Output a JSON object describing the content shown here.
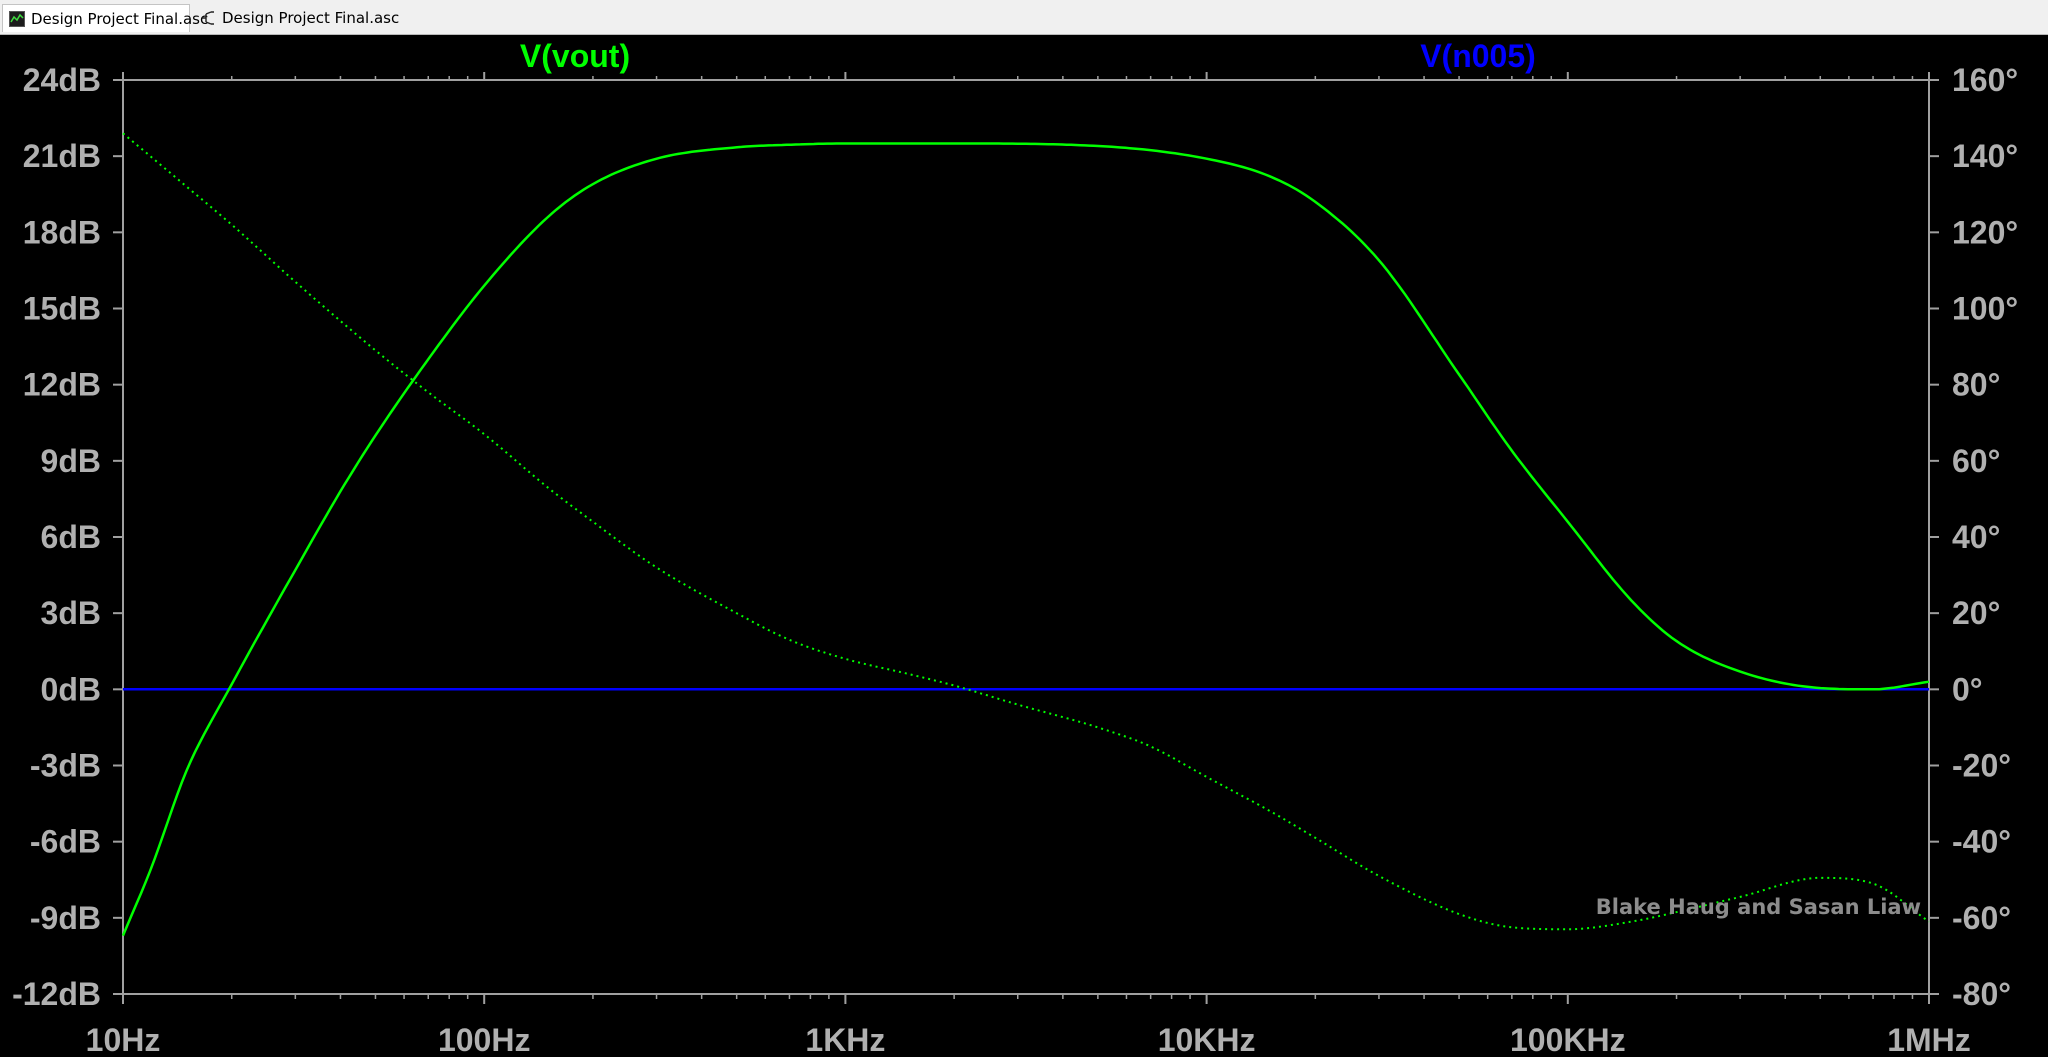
{
  "window": {
    "tabs": [
      {
        "label": "Design Project Final.asc",
        "icon": "waveform-icon",
        "active": true
      },
      {
        "label": "Design Project Final.asc",
        "icon": "schematic-icon",
        "active": false
      }
    ]
  },
  "watermark": "Blake Haug and Sasan Liaw",
  "colors": {
    "background": "#000000",
    "axis": "#a0a0a0",
    "tick_text": "#b0b0b0",
    "vout": "#00ff00",
    "n005": "#0000ff"
  },
  "chart_data": {
    "type": "line",
    "x_scale": "log",
    "xlim": [
      10,
      1000000
    ],
    "x_ticks": [
      {
        "value": 10,
        "label": "10Hz"
      },
      {
        "value": 100,
        "label": "100Hz"
      },
      {
        "value": 1000,
        "label": "1KHz"
      },
      {
        "value": 10000,
        "label": "10KHz"
      },
      {
        "value": 100000,
        "label": "100KHz"
      },
      {
        "value": 1000000,
        "label": "1MHz"
      }
    ],
    "y_left": {
      "unit": "dB",
      "lim": [
        -12,
        24
      ],
      "ticks": [
        {
          "value": 24,
          "label": "24dB"
        },
        {
          "value": 21,
          "label": "21dB"
        },
        {
          "value": 18,
          "label": "18dB"
        },
        {
          "value": 15,
          "label": "15dB"
        },
        {
          "value": 12,
          "label": "12dB"
        },
        {
          "value": 9,
          "label": "9dB"
        },
        {
          "value": 6,
          "label": "6dB"
        },
        {
          "value": 3,
          "label": "3dB"
        },
        {
          "value": 0,
          "label": "0dB"
        },
        {
          "value": -3,
          "label": "-3dB"
        },
        {
          "value": -6,
          "label": "-6dB"
        },
        {
          "value": -9,
          "label": "-9dB"
        },
        {
          "value": -12,
          "label": "-12dB"
        }
      ]
    },
    "y_right": {
      "unit": "°",
      "lim": [
        -80,
        160
      ],
      "ticks": [
        {
          "value": 160,
          "label": "160°"
        },
        {
          "value": 140,
          "label": "140°"
        },
        {
          "value": 120,
          "label": "120°"
        },
        {
          "value": 100,
          "label": "100°"
        },
        {
          "value": 80,
          "label": "80°"
        },
        {
          "value": 60,
          "label": "60°"
        },
        {
          "value": 40,
          "label": "40°"
        },
        {
          "value": 20,
          "label": "20°"
        },
        {
          "value": 0,
          "label": "0°"
        },
        {
          "value": -20,
          "label": "-20°"
        },
        {
          "value": -40,
          "label": "-40°"
        },
        {
          "value": -60,
          "label": "-60°"
        },
        {
          "value": -80,
          "label": "-80°"
        }
      ]
    },
    "series": [
      {
        "name": "V(vout)",
        "color": "#00ff00",
        "magnitude_db": {
          "x": [
            10,
            12,
            15,
            20,
            25,
            30,
            40,
            50,
            70,
            100,
            150,
            200,
            300,
            500,
            700,
            1000,
            2000,
            5000,
            10000,
            15000,
            20000,
            30000,
            50000,
            70000,
            100000,
            150000,
            200000,
            300000,
            500000,
            700000,
            1000000
          ],
          "y": [
            -9.7,
            -7.0,
            -3.2,
            0.2,
            2.7,
            4.7,
            7.8,
            10.0,
            13.0,
            15.9,
            18.6,
            19.9,
            20.9,
            21.35,
            21.45,
            21.5,
            21.5,
            21.4,
            20.9,
            20.2,
            19.2,
            16.9,
            12.4,
            9.4,
            6.6,
            3.5,
            1.9,
            0.7,
            0.05,
            0.0,
            0.3
          ]
        },
        "phase_deg": {
          "x": [
            10,
            15,
            20,
            30,
            50,
            70,
            100,
            150,
            200,
            300,
            500,
            700,
            1000,
            1500,
            2000,
            3000,
            5000,
            7000,
            10000,
            15000,
            20000,
            30000,
            50000,
            70000,
            100000,
            150000,
            200000,
            300000,
            500000,
            700000,
            1000000
          ],
          "y": [
            146,
            132,
            122,
            107,
            89,
            78,
            67,
            53,
            44,
            32,
            20,
            13,
            8,
            4,
            1,
            -4,
            -10,
            -15,
            -23,
            -32,
            -39,
            -49,
            -59,
            -62.5,
            -63,
            -61,
            -58.5,
            -54.5,
            -49.5,
            -51,
            -61
          ]
        }
      },
      {
        "name": "V(n005)",
        "color": "#0000ff",
        "magnitude_db": {
          "x": [
            10,
            1000000
          ],
          "y": [
            0,
            0
          ]
        }
      }
    ]
  }
}
